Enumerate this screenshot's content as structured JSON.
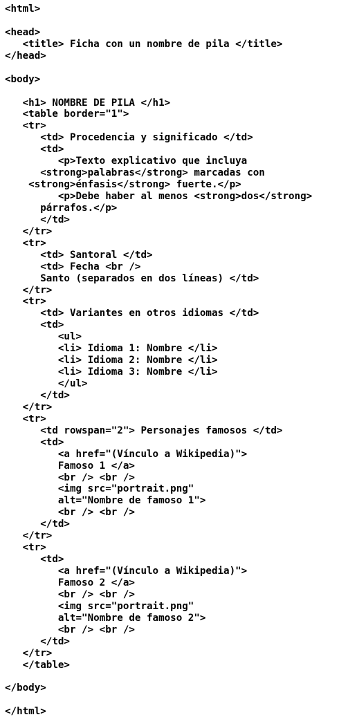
{
  "document": {
    "lines": [
      "<html>",
      "",
      "<head>",
      "   <title> Ficha con un nombre de pila </title>",
      "</head>",
      "",
      "<body>",
      "",
      "   <h1> NOMBRE DE PILA </h1>",
      "   <table border=\"1\">",
      "   <tr>",
      "      <td> Procedencia y significado </td>",
      "      <td>",
      "         <p>Texto explicativo que incluya",
      "      <strong>palabras</strong> marcadas con",
      "    <strong>énfasis</strong> fuerte.</p>",
      "         <p>Debe haber al menos <strong>dos</strong>",
      "      párrafos.</p>",
      "      </td>",
      "   </tr>",
      "   <tr>",
      "      <td> Santoral </td>",
      "      <td> Fecha <br />",
      "      Santo (separados en dos líneas) </td>",
      "   </tr>",
      "   <tr>",
      "      <td> Variantes en otros idiomas </td>",
      "      <td>",
      "         <ul>",
      "         <li> Idioma 1: Nombre </li>",
      "         <li> Idioma 2: Nombre </li>",
      "         <li> Idioma 3: Nombre </li>",
      "         </ul>",
      "      </td>",
      "   </tr>",
      "   <tr>",
      "      <td rowspan=\"2\"> Personajes famosos </td>",
      "      <td>",
      "         <a href=\"(Vínculo a Wikipedia)\">",
      "         Famoso 1 </a>",
      "         <br /> <br />",
      "         <img src=\"portrait.png\"",
      "         alt=\"Nombre de famoso 1\">",
      "         <br /> <br />",
      "      </td>",
      "   </tr>",
      "   <tr>",
      "      <td>",
      "         <a href=\"(Vínculo a Wikipedia)\">",
      "         Famoso 2 </a>",
      "         <br /> <br />",
      "         <img src=\"portrait.png\"",
      "         alt=\"Nombre de famoso 2\">",
      "         <br /> <br />",
      "      </td>",
      "   </tr>",
      "   </table>",
      "",
      "</body>",
      "",
      "</html>"
    ]
  }
}
